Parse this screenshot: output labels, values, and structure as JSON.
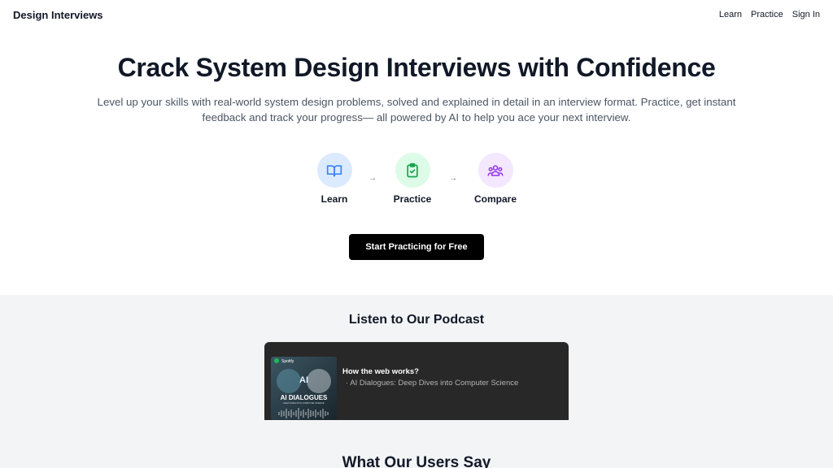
{
  "nav": {
    "brand": "Design Interviews",
    "links": [
      "Learn",
      "Practice",
      "Sign In"
    ]
  },
  "hero": {
    "title": "Crack System Design Interviews with Confidence",
    "subtitle": "Level up your skills with real-world system design problems, solved and explained in detail in an interview format. Practice, get instant feedback and track your progress— all powered by AI to help you ace your next interview."
  },
  "steps": [
    {
      "label": "Learn",
      "icon": "book-icon",
      "bg": "#dbeafe",
      "color": "#3b82f6"
    },
    {
      "label": "Practice",
      "icon": "clipboard-check-icon",
      "bg": "#dcfce7",
      "color": "#16a34a"
    },
    {
      "label": "Compare",
      "icon": "users-icon",
      "bg": "#f3e8ff",
      "color": "#9333ea"
    }
  ],
  "cta": {
    "label": "Start Practicing for Free"
  },
  "podcast": {
    "title": "Listen to Our Podcast",
    "episode_title": "How the web works?",
    "show_name": "· AI Dialogues: Deep Dives into Computer Science",
    "cover_brand": "Spotify",
    "cover_title": "AI DIALOGUES",
    "cover_subtitle": "DEEP DIVES INTO COMPUTER SCIENCE",
    "cover_mark": "AI"
  },
  "testimonials": {
    "title": "What Our Users Say"
  },
  "colors": {
    "primary": "#000000",
    "section_bg": "#f3f4f6",
    "player_bg": "#282828"
  }
}
